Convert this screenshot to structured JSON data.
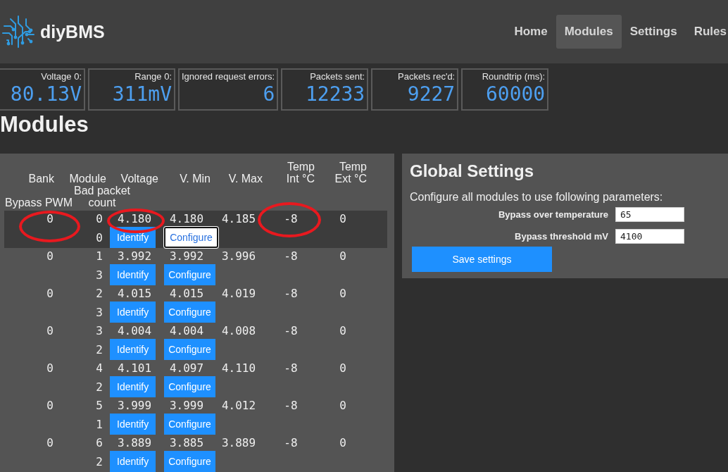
{
  "header": {
    "brand": "diyBMS",
    "nav": [
      {
        "label": "Home",
        "selected": false
      },
      {
        "label": "Modules",
        "selected": true
      },
      {
        "label": "Settings",
        "selected": false
      },
      {
        "label": "Rules",
        "selected": false
      }
    ]
  },
  "stats": [
    {
      "label": "Voltage 0:",
      "value": "80.13V"
    },
    {
      "label": "Range 0:",
      "value": "311mV"
    },
    {
      "label": "Ignored request errors:",
      "value": "6"
    },
    {
      "label": "Packets sent:",
      "value": "12233"
    },
    {
      "label": "Packets rec'd:",
      "value": "9227"
    },
    {
      "label": "Roundtrip (ms):",
      "value": "60000"
    }
  ],
  "page_title": "Modules",
  "table": {
    "columns": [
      "Bank",
      "Module",
      "Voltage",
      "V. Min",
      "V. Max",
      "Temp Int °C",
      "Temp Ext °C",
      "Bypass PWM",
      "Bad packet count"
    ],
    "rows": [
      {
        "selected": true,
        "cells": [
          {
            "text": "0",
            "circled": true
          },
          {
            "text": "0",
            "circled": false
          },
          {
            "text": "4.180",
            "circled": true
          },
          {
            "text": "4.180",
            "circled": false
          },
          {
            "text": "4.185",
            "circled": false
          },
          {
            "text": "-8",
            "circled": true
          },
          {
            "text": "0",
            "circled": false
          }
        ],
        "bad_packet_count": "0",
        "actions": [
          {
            "kind": "identify",
            "label": "Identify",
            "focused": false
          },
          {
            "kind": "configure",
            "label": "Configure",
            "focused": true
          }
        ]
      },
      {
        "selected": false,
        "cells": [
          {
            "text": "0",
            "circled": false
          },
          {
            "text": "1",
            "circled": false
          },
          {
            "text": "3.992",
            "circled": false
          },
          {
            "text": "3.992",
            "circled": false
          },
          {
            "text": "3.996",
            "circled": false
          },
          {
            "text": "-8",
            "circled": false
          },
          {
            "text": "0",
            "circled": false
          }
        ],
        "bad_packet_count": "3",
        "actions": [
          {
            "kind": "identify",
            "label": "Identify",
            "focused": false
          },
          {
            "kind": "configure",
            "label": "Configure",
            "focused": false
          }
        ]
      },
      {
        "selected": false,
        "cells": [
          {
            "text": "0",
            "circled": false
          },
          {
            "text": "2",
            "circled": false
          },
          {
            "text": "4.015",
            "circled": false
          },
          {
            "text": "4.015",
            "circled": false
          },
          {
            "text": "4.019",
            "circled": false
          },
          {
            "text": "-8",
            "circled": false
          },
          {
            "text": "0",
            "circled": false
          }
        ],
        "bad_packet_count": "3",
        "actions": [
          {
            "kind": "identify",
            "label": "Identify",
            "focused": false
          },
          {
            "kind": "configure",
            "label": "Configure",
            "focused": false
          }
        ]
      },
      {
        "selected": false,
        "cells": [
          {
            "text": "0",
            "circled": false
          },
          {
            "text": "3",
            "circled": false
          },
          {
            "text": "4.004",
            "circled": false
          },
          {
            "text": "4.004",
            "circled": false
          },
          {
            "text": "4.008",
            "circled": false
          },
          {
            "text": "-8",
            "circled": false
          },
          {
            "text": "0",
            "circled": false
          }
        ],
        "bad_packet_count": "2",
        "actions": [
          {
            "kind": "identify",
            "label": "Identify",
            "focused": false
          },
          {
            "kind": "configure",
            "label": "Configure",
            "focused": false
          }
        ]
      },
      {
        "selected": false,
        "cells": [
          {
            "text": "0",
            "circled": false
          },
          {
            "text": "4",
            "circled": false
          },
          {
            "text": "4.101",
            "circled": false
          },
          {
            "text": "4.097",
            "circled": false
          },
          {
            "text": "4.110",
            "circled": false
          },
          {
            "text": "-8",
            "circled": false
          },
          {
            "text": "0",
            "circled": false
          }
        ],
        "bad_packet_count": "2",
        "actions": [
          {
            "kind": "identify",
            "label": "Identify",
            "focused": false
          },
          {
            "kind": "configure",
            "label": "Configure",
            "focused": false
          }
        ]
      },
      {
        "selected": false,
        "cells": [
          {
            "text": "0",
            "circled": false
          },
          {
            "text": "5",
            "circled": false
          },
          {
            "text": "3.999",
            "circled": false
          },
          {
            "text": "3.999",
            "circled": false
          },
          {
            "text": "4.012",
            "circled": false
          },
          {
            "text": "-8",
            "circled": false
          },
          {
            "text": "0",
            "circled": false
          }
        ],
        "bad_packet_count": "1",
        "actions": [
          {
            "kind": "identify",
            "label": "Identify",
            "focused": false
          },
          {
            "kind": "configure",
            "label": "Configure",
            "focused": false
          }
        ]
      },
      {
        "selected": false,
        "cells": [
          {
            "text": "0",
            "circled": false
          },
          {
            "text": "6",
            "circled": false
          },
          {
            "text": "3.889",
            "circled": false
          },
          {
            "text": "3.885",
            "circled": false
          },
          {
            "text": "3.889",
            "circled": false
          },
          {
            "text": "-8",
            "circled": false
          },
          {
            "text": "0",
            "circled": false
          }
        ],
        "bad_packet_count": "2",
        "actions": [
          {
            "kind": "identify",
            "label": "Identify",
            "focused": false
          },
          {
            "kind": "configure",
            "label": "Configure",
            "focused": false
          }
        ]
      }
    ]
  },
  "global_settings": {
    "title": "Global Settings",
    "description": "Configure all modules to use following parameters:",
    "fields": [
      {
        "label": "Bypass over temperature",
        "value": "65"
      },
      {
        "label": "Bypass threshold mV",
        "value": "4100"
      }
    ],
    "save_button": "Save settings"
  }
}
